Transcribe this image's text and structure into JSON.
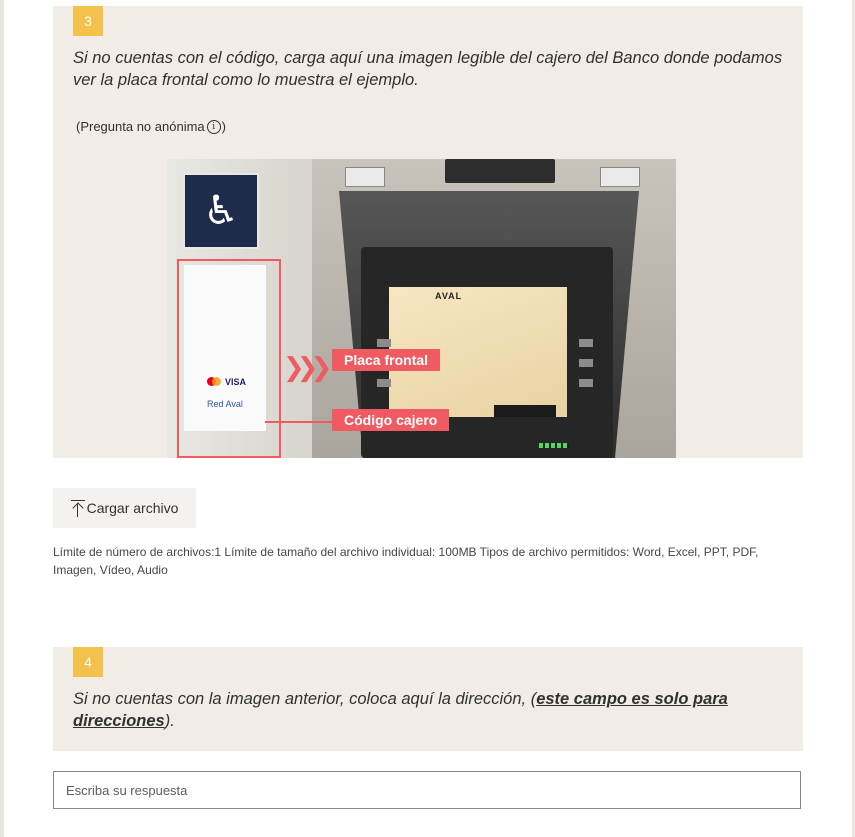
{
  "colors": {
    "question_background": "#f1ede6",
    "number_badge": "#f4c14c",
    "annotation_red": "#ef5b61"
  },
  "question3": {
    "number": "3",
    "title": "Si no cuentas con el código, carga aquí una imagen legible del cajero del Banco donde podamos ver la placa frontal como lo muestra el ejemplo.",
    "non_anonymous_label": "(Pregunta no anónima",
    "info_icon_glyph": "i",
    "non_anonymous_close": ")",
    "example_image": {
      "label_placa": "Placa frontal",
      "label_codigo": "Código cajero",
      "screen_logo": "AVAL",
      "sticker_visa": "VISA",
      "sticker_red": "Red Aval",
      "arrows": "❯❯❯",
      "wheelchair_icon": "♿"
    },
    "upload_button_label": "Cargar archivo",
    "file_limits": "Límite de número de archivos:1    Límite de tamaño del archivo individual: 100MB    Tipos de archivo permitidos: Word, Excel, PPT, PDF, Imagen, Vídeo, Audio"
  },
  "question4": {
    "number": "4",
    "title_prefix": "Si no cuentas con la imagen anterior, coloca aquí la dirección, (",
    "title_emphasis": "este campo es solo para direcciones",
    "title_suffix": ").",
    "answer_placeholder": "Escriba su respuesta",
    "answer_value": ""
  }
}
